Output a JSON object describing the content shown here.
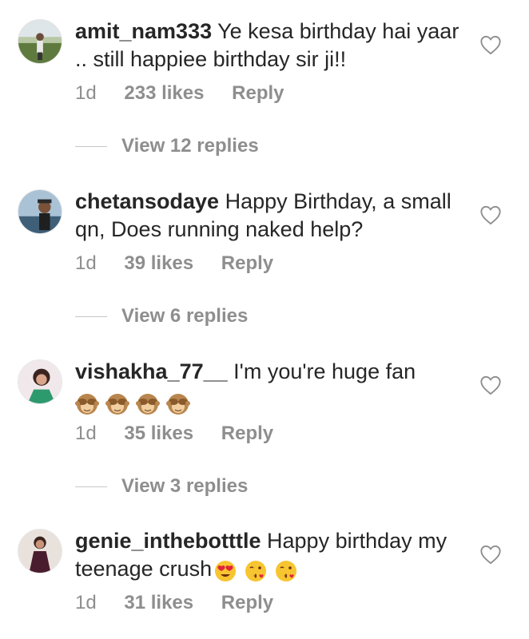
{
  "comments": [
    {
      "username": "amit_nam333",
      "text": "Ye kesa birthday hai yaar .. still happiee birthday sir ji!!",
      "age": "1d",
      "likes": "233 likes",
      "reply": "Reply",
      "view_replies": "View 12 replies"
    },
    {
      "username": "chetansodaye",
      "text": "Happy Birthday, a small qn, Does running naked help?",
      "age": "1d",
      "likes": "39 likes",
      "reply": "Reply",
      "view_replies": "View 6 replies"
    },
    {
      "username": "vishakha_77__",
      "text": "I'm you're huge fan",
      "age": "1d",
      "likes": "35 likes",
      "reply": "Reply",
      "view_replies": "View 3 replies",
      "emojis": [
        "see-no-evil-monkey",
        "see-no-evil-monkey",
        "see-no-evil-monkey",
        "see-no-evil-monkey"
      ]
    },
    {
      "username": "genie_inthebotttle",
      "text": "Happy birthday my teenage crush",
      "age": "1d",
      "likes": "31 likes",
      "reply": "Reply",
      "emojis": [
        "heart-eyes-face",
        "kissing-face",
        "kissing-face"
      ]
    }
  ],
  "icons": {
    "like": "heart-outline-icon"
  },
  "colors": {
    "text": "#262626",
    "secondary": "#8e8e8e",
    "divider": "#c7c7c7"
  }
}
